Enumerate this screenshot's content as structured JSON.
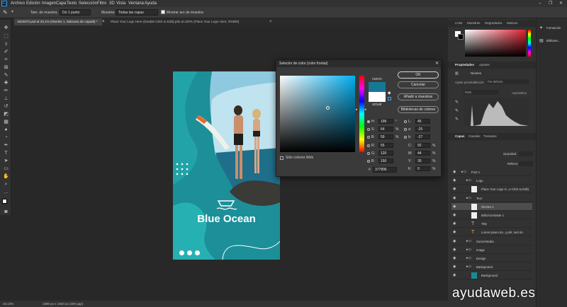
{
  "app": {
    "logo": "Ps",
    "menu": [
      "Archivo",
      "Edición",
      "Imagen",
      "Capa",
      "Texto",
      "Selección",
      "Filtro",
      "3D",
      "Vista",
      "Ventana",
      "Ayuda"
    ],
    "window_controls": [
      "–",
      "❐",
      "✕"
    ]
  },
  "options_bar": {
    "sample_size_label": "Tam. de muestra:",
    "sample_size_value": "De 1 punto",
    "sample_label": "Muestra:",
    "sample_value": "Todas las capas",
    "show_ring_label": "Mostrar aro de muestra"
  },
  "tabs": [
    {
      "label": "1823670.psd al 33,1% (Niveles 1, Máscara de capa/8) *",
      "close": "×"
    },
    {
      "label": "Place Your Logo Here (Double-Click to Edit).psb al 100% (Place Your Logo Here, RGB/8)",
      "close": "×"
    }
  ],
  "document": {
    "headline": "Blue Ocean",
    "social_icons": [
      "twitter-icon",
      "facebook-icon",
      "instagram-icon"
    ]
  },
  "status_bar": {
    "zoom": "33,13%",
    "doc_size": "1080 px x 1920 px (300 ppp)"
  },
  "panels": {
    "color_tabs": [
      "Color",
      "Muestras",
      "Degradados",
      "Motivos"
    ],
    "properties_tabs": [
      "Propiedades",
      "Ajustes"
    ],
    "properties_title": "Niveles",
    "preset_label": "Ajuste preestablecido:",
    "preset_value": "Por defecto",
    "channel_value": "RGB",
    "auto_label": "Automático",
    "layers_tabs": [
      "Capas",
      "Canales",
      "Trazados"
    ],
    "opacity_label": "Opacidad:",
    "fill_label": "Relleno:",
    "side_items": [
      "Formación",
      "Bibliotec..."
    ],
    "layers": [
      {
        "name": "Post 1",
        "type": "group",
        "indent": 0
      },
      {
        "name": "Logo",
        "type": "group",
        "indent": 1
      },
      {
        "name": "Place Your Logo H...e-Click to Edit)",
        "type": "smart",
        "indent": 2
      },
      {
        "name": "Text",
        "type": "group",
        "indent": 1
      },
      {
        "name": "Niveles 1",
        "type": "adjust",
        "indent": 2,
        "selected": true
      },
      {
        "name": "Brillo/contraste 1",
        "type": "adjust",
        "indent": 2
      },
      {
        "name": "Title",
        "type": "text",
        "indent": 2
      },
      {
        "name": "Lorem ipsum do...g elit, sed do",
        "type": "text",
        "indent": 2
      },
      {
        "name": "Social Media",
        "type": "group",
        "indent": 1
      },
      {
        "name": "Image",
        "type": "group",
        "indent": 1
      },
      {
        "name": "Design",
        "type": "group",
        "indent": 1
      },
      {
        "name": "Background",
        "type": "group",
        "indent": 1
      },
      {
        "name": "Background",
        "type": "fill",
        "indent": 2
      }
    ]
  },
  "color_picker": {
    "title": "Selector de color (color frontal)",
    "ok": "OK",
    "cancel": "Cancelar",
    "add_swatches": "Añadir a muestras",
    "libraries": "Bibliotecas de colores",
    "new_label": "nuevo",
    "current_label": "actual",
    "web_only_label": "Sólo colores Web",
    "new_color": "#177896",
    "current_color": "#ffffff",
    "fields": {
      "H": {
        "value": "199",
        "unit": "°"
      },
      "S": {
        "value": "64",
        "unit": "%"
      },
      "B": {
        "value": "59",
        "unit": "%"
      },
      "R": {
        "value": "55",
        "unit": ""
      },
      "G": {
        "value": "120",
        "unit": ""
      },
      "Bl": {
        "value": "150",
        "unit": ""
      },
      "L": {
        "value": "45",
        "unit": ""
      },
      "a": {
        "value": "-25",
        "unit": ""
      },
      "b": {
        "value": "-27",
        "unit": ""
      },
      "C": {
        "value": "92",
        "unit": "%"
      },
      "M": {
        "value": "44",
        "unit": "%"
      },
      "Y": {
        "value": "35",
        "unit": "%"
      },
      "K": {
        "value": "0",
        "unit": "%"
      }
    },
    "hex_label": "#",
    "hex": "377896"
  },
  "watermark": "ayudaweb.es"
}
